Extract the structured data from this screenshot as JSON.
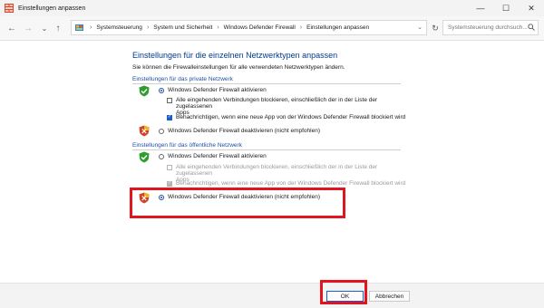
{
  "window": {
    "title": "Einstellungen anpassen",
    "controls": [
      "—",
      "☐",
      "✕"
    ]
  },
  "nav": {
    "back": "←",
    "forward": "→",
    "dropdown": "⌄",
    "up": "↑"
  },
  "address": {
    "breadcrumbs": [
      "Systemsteuerung",
      "System und Sicherheit",
      "Windows Defender Firewall",
      "Einstellungen anpassen"
    ],
    "separator": "›",
    "refresh": "↻",
    "search_placeholder": "Systemsteuerung durchsuch..."
  },
  "main": {
    "heading": "Einstellungen für die einzelnen Netzwerktypen anpassen",
    "subtext": "Sie können die Firewalleinstellungen für alle verwendeten Netzwerktypen ändern.",
    "private": {
      "label": "Einstellungen für das private Netzwerk",
      "activate": "Windows Defender Firewall aktivieren",
      "block_all": "Alle eingehenden Verbindungen blockieren, einschließlich der in der Liste der zugelassenen",
      "block_all_cont": "Apps",
      "notify": "Benachrichtigen, wenn eine neue App von der Windows Defender Firewall blockiert wird",
      "deactivate": "Windows Defender Firewall deaktivieren (nicht empfohlen)",
      "activate_selected": true,
      "block_all_checked": false,
      "notify_checked": true
    },
    "public": {
      "label": "Einstellungen für das öffentliche Netzwerk",
      "activate": "Windows Defender Firewall aktivieren",
      "block_all": "Alle eingehenden Verbindungen blockieren, einschließlich der in der Liste der zugelassenen",
      "block_all_cont": "Apps",
      "notify": "Benachrichtigen, wenn eine neue App von der Windows Defender Firewall blockiert wird",
      "deactivate": "Windows Defender Firewall deaktivieren (nicht empfohlen)",
      "deactivate_selected": true,
      "block_all_checked": false,
      "notify_checked": true
    }
  },
  "footer": {
    "ok": "OK",
    "cancel": "Abbrechen"
  },
  "colors": {
    "highlight": "#e2151e",
    "heading": "#003a8c",
    "group_label": "#1e4fa8",
    "shield_green": "#2f9e2f",
    "shield_red": "#d0452a",
    "shield_yellow": "#f2b21b"
  }
}
